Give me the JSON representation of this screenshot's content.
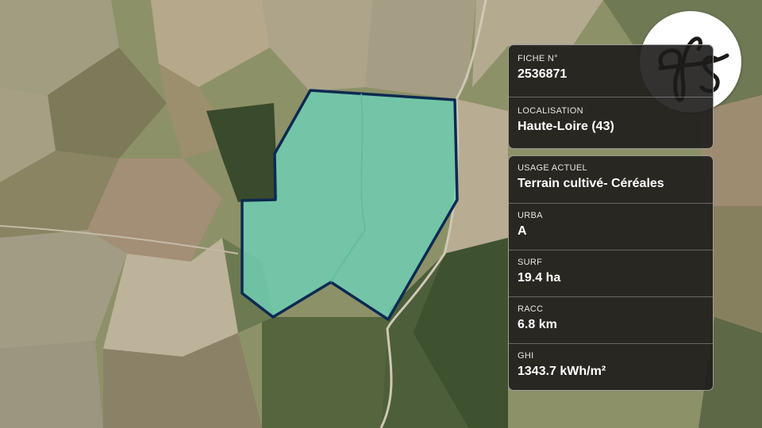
{
  "map": {
    "view": "satellite",
    "parcel_fill": "#6fd1b5",
    "parcel_outline": "#0c2a52"
  },
  "logo": {
    "icon": "fs-logo-icon"
  },
  "info_top": [
    {
      "label": "FICHE N°",
      "value": "2536871"
    },
    {
      "label": "LOCALISATION",
      "value": "Haute-Loire (43)"
    }
  ],
  "info_bottom": [
    {
      "label": "USAGE ACTUEL",
      "value": "Terrain cultivé- Céréales"
    },
    {
      "label": "URBA",
      "value": "A"
    },
    {
      "label": "SURF",
      "value": "19.4 ha"
    },
    {
      "label": "RACC",
      "value": "6.8 km"
    },
    {
      "label": "GHI",
      "value": "1343.7 kWh/m²"
    }
  ]
}
